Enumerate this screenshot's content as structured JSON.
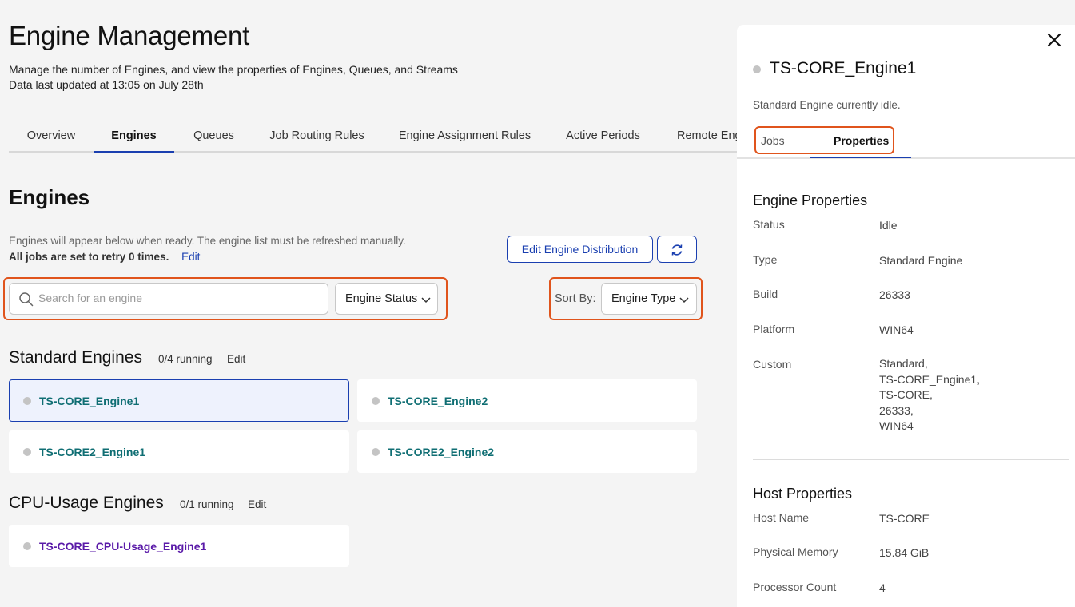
{
  "page": {
    "title": "Engine Management",
    "subtitle_line1": "Manage the number of Engines, and view the properties of Engines, Queues, and Streams",
    "subtitle_line2": "Data last updated at 13:05 on July 28th"
  },
  "tabs": [
    "Overview",
    "Engines",
    "Queues",
    "Job Routing Rules",
    "Engine Assignment Rules",
    "Active Periods",
    "Remote Engines"
  ],
  "active_tab": "Engines",
  "engines": {
    "title": "Engines",
    "hint": "Engines will appear below when ready. The engine list must be refreshed manually.",
    "retry_text": "All jobs are set to retry 0 times.",
    "edit_label": "Edit",
    "edit_distribution_label": "Edit Engine Distribution",
    "refresh_icon": "refresh-icon",
    "search_placeholder": "Search for an engine",
    "status_filter": "Engine Status",
    "sort_label": "Sort By:",
    "sort_value": "Engine Type"
  },
  "groups": [
    {
      "title": "Standard Engines",
      "running": "0/4 running",
      "edit": "Edit",
      "engines": [
        "TS-CORE_Engine1",
        "TS-CORE_Engine2",
        "TS-CORE2_Engine1",
        "TS-CORE2_Engine2"
      ]
    },
    {
      "title": "CPU-Usage Engines",
      "running": "0/1 running",
      "edit": "Edit",
      "engines": [
        "TS-CORE_CPU-Usage_Engine1"
      ]
    }
  ],
  "panel": {
    "title": "TS-CORE_Engine1",
    "status_text": "Standard Engine currently idle.",
    "tabs": [
      "Jobs",
      "Properties"
    ],
    "active_tab": "Properties",
    "engine_properties_title": "Engine Properties",
    "engine_properties": [
      {
        "label": "Status",
        "value": "Idle"
      },
      {
        "label": "Type",
        "value": "Standard Engine"
      },
      {
        "label": "Build",
        "value": "26333"
      },
      {
        "label": "Platform",
        "value": "WIN64"
      },
      {
        "label": "Custom",
        "value": [
          "Standard,",
          "TS-CORE_Engine1,",
          "TS-CORE,",
          "26333,",
          "WIN64"
        ]
      }
    ],
    "host_properties_title": "Host Properties",
    "host_properties": [
      {
        "label": "Host Name",
        "value": "TS-CORE"
      },
      {
        "label": "Physical Memory",
        "value": "15.84 GiB"
      },
      {
        "label": "Processor Count",
        "value": "4"
      }
    ]
  },
  "colors": {
    "accent": "#1a3fb0",
    "highlight": "#e0541c",
    "engine_link": "#0f6e73",
    "cpu_engine_link": "#5a1aa8",
    "status_idle": "#c4c4c4"
  }
}
